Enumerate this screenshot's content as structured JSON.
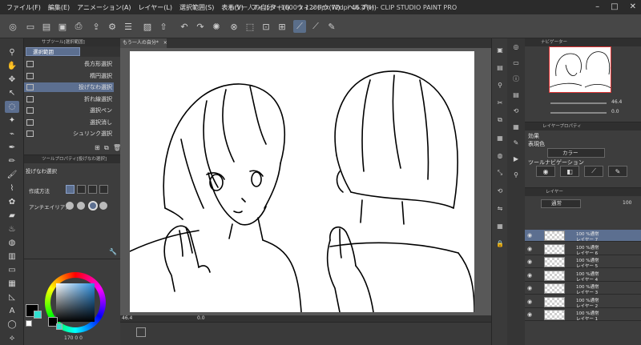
{
  "app": {
    "title": "もう一人の自分* (1600 x 1200px 72dpi 46.4%)  - CLIP STUDIO PAINT PRO"
  },
  "menu": [
    "ファイル(F)",
    "編集(E)",
    "アニメーション(A)",
    "レイヤー(L)",
    "選択範囲(S)",
    "表示(V)",
    "フィルター(I)",
    "ウィンドウ(W)",
    "ヘルプ(H)"
  ],
  "subtool": {
    "header": "サブツール[選択範囲]",
    "tab": "選択範囲",
    "items": [
      {
        "label": "長方形選択",
        "selected": false
      },
      {
        "label": "楕円選択",
        "selected": false
      },
      {
        "label": "投げなわ選択",
        "selected": true
      },
      {
        "label": "折れ線選択",
        "selected": false
      },
      {
        "label": "選択ペン",
        "selected": false
      },
      {
        "label": "選択消し",
        "selected": false
      },
      {
        "label": "シュリンク選択",
        "selected": false
      }
    ]
  },
  "toolprop": {
    "header": "ツールプロパティ[投げなわ選択]",
    "name": "投げなわ選択",
    "rows": [
      {
        "label": "作成方法"
      },
      {
        "label": "アンチエイリアス"
      }
    ]
  },
  "color": {
    "main": "#000000",
    "sub": "#32e0d0",
    "values": "170  0  0"
  },
  "canvas": {
    "tab": "もう一人の自分*",
    "zoom": "46.4",
    "rotation": "0.0"
  },
  "navigator": {
    "header": "ナビゲーター",
    "zoom": "46.4",
    "rotation": "0.0"
  },
  "layerprop": {
    "header": "レイヤープロパティ",
    "effect_label": "効果",
    "expression_label": "表現色",
    "color_value": "カラー",
    "toolnav_label": "ツールナビゲーション"
  },
  "layers": {
    "header": "レイヤー",
    "blend": "通常",
    "opacity": "100",
    "list": [
      {
        "line1": "100 %通常",
        "line2": "レイヤー 7",
        "selected": true
      },
      {
        "line1": "100 %通常",
        "line2": "レイヤー 6",
        "selected": false
      },
      {
        "line1": "100 %通常",
        "line2": "レイヤー 5",
        "selected": false
      },
      {
        "line1": "100 %通常",
        "line2": "レイヤー 4",
        "selected": false
      },
      {
        "line1": "100 %通常",
        "line2": "レイヤー 3",
        "selected": false
      },
      {
        "line1": "100 %通常",
        "line2": "レイヤー 2",
        "selected": false
      },
      {
        "line1": "100 %通常",
        "line2": "レイヤー 1",
        "selected": false
      }
    ]
  },
  "colors": {
    "accent": "#5c6f90",
    "bg": "#3c3c3c"
  }
}
